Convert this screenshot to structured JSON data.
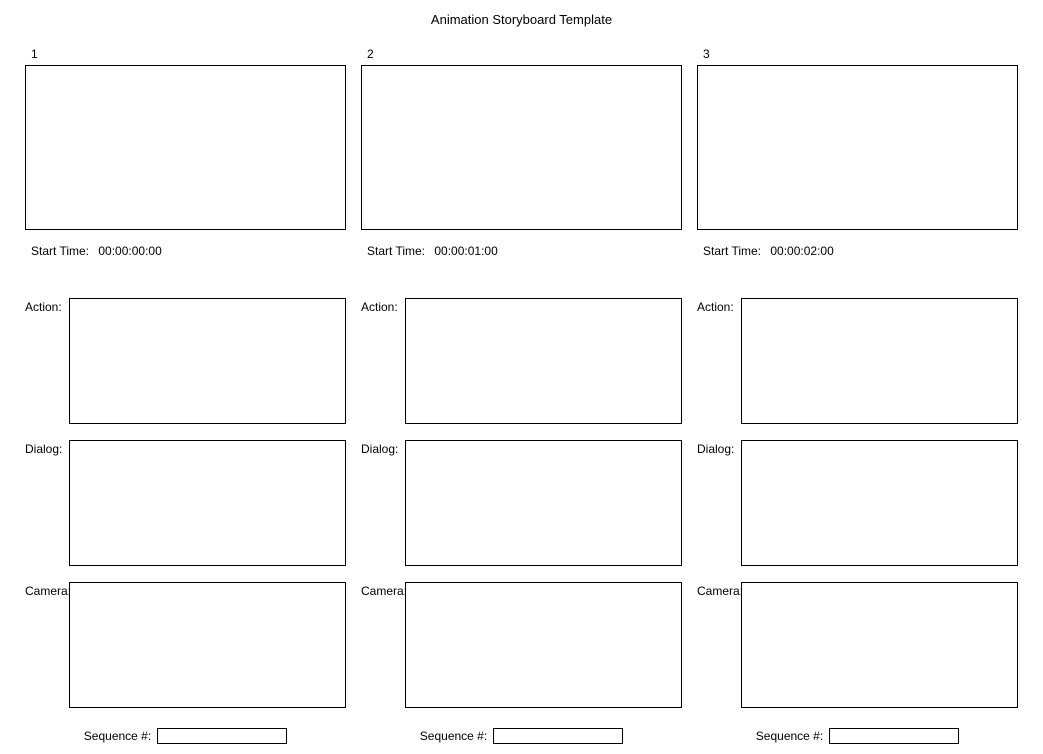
{
  "title": "Animation Storyboard Template",
  "labels": {
    "startTime": "Start Time:",
    "action": "Action:",
    "dialog": "Dialog:",
    "camera": "Camera:",
    "sequence": "Sequence #:"
  },
  "panels": [
    {
      "number": "1",
      "startTime": "00:00:00:00",
      "action": "",
      "dialog": "",
      "camera": "",
      "sequence": ""
    },
    {
      "number": "2",
      "startTime": "00:00:01:00",
      "action": "",
      "dialog": "",
      "camera": "",
      "sequence": ""
    },
    {
      "number": "3",
      "startTime": "00:00:02:00",
      "action": "",
      "dialog": "",
      "camera": "",
      "sequence": ""
    }
  ]
}
